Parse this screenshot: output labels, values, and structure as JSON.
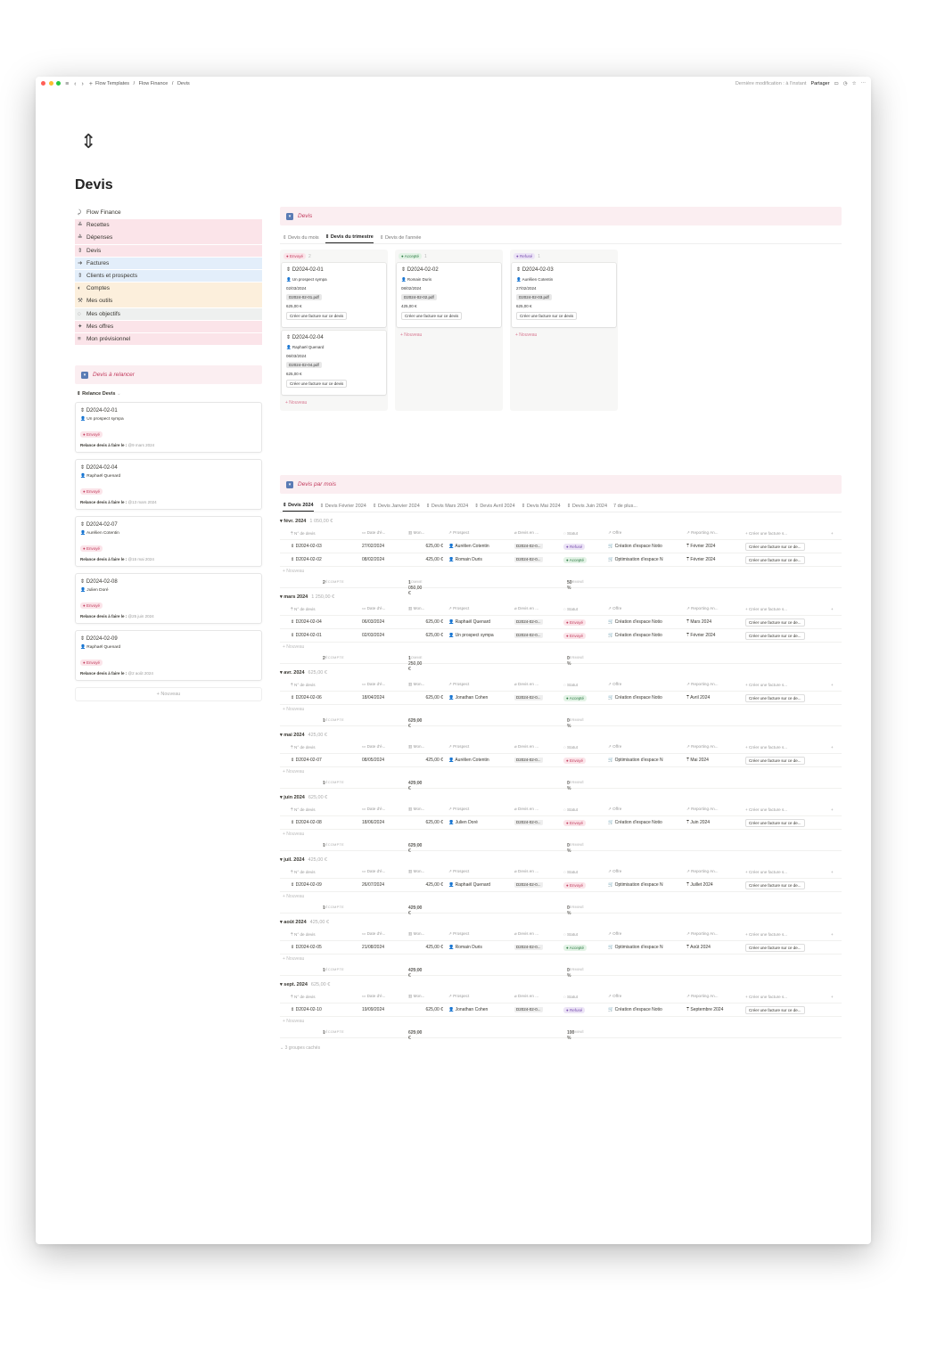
{
  "topbar": {
    "crumbs": [
      "Flow Templates",
      "/",
      "Flow Finance",
      "/",
      "Devis"
    ],
    "last_modified": "Dernière modification : à l'instant",
    "share": "Partager"
  },
  "page": {
    "title": "Devis"
  },
  "nav": [
    {
      "icon": "⤸",
      "label": "Flow Finance",
      "bg": "#ffffff"
    },
    {
      "icon": "≚",
      "label": "Recettes",
      "bg": "#fbe4e9"
    },
    {
      "icon": "≙",
      "label": "Dépenses",
      "bg": "#fbe4e9"
    },
    {
      "icon": "⇕",
      "label": "Devis",
      "bg": "#fbe4e9"
    },
    {
      "icon": "➜",
      "label": "Factures",
      "bg": "#e3eefa"
    },
    {
      "icon": "⇕",
      "label": "Clients et prospects",
      "bg": "#e3eefa"
    },
    {
      "icon": "◐",
      "label": "Comptes",
      "bg": "#fcefdc"
    },
    {
      "icon": "⚒",
      "label": "Mes outils",
      "bg": "#fcefdc"
    },
    {
      "icon": "◌",
      "label": "Mes objectifs",
      "bg": "#eef0ef"
    },
    {
      "icon": "✦",
      "label": "Mes offres",
      "bg": "#fbe4e9"
    },
    {
      "icon": "≡",
      "label": "Mon prévisionnel",
      "bg": "#fbe4e9"
    }
  ],
  "relance": {
    "title": "Devis à relancer",
    "view": "Relance Devis",
    "label": "Relance devis à faire le :",
    "cards": [
      {
        "id": "D2024-02-01",
        "person": "Un prospect sympa",
        "status": "Envoyé",
        "date": "@9 mars 2024"
      },
      {
        "id": "D2024-02-04",
        "person": "Raphaël Quenard",
        "status": "Envoyé",
        "date": "@13 mars 2024"
      },
      {
        "id": "D2024-02-07",
        "person": "Aurélien Cotentin",
        "status": "Envoyé",
        "date": "@15 mai 2024"
      },
      {
        "id": "D2024-02-08",
        "person": "Julien Doré",
        "status": "Envoyé",
        "date": "@25 juin 2024"
      },
      {
        "id": "D2024-02-09",
        "person": "Raphaël Quenard",
        "status": "Envoyé",
        "date": "@2 août 2024"
      }
    ],
    "new": "+ Nouveau"
  },
  "board": {
    "title": "Devis",
    "tabs": [
      "Devis du mois",
      "Devis du trimestre",
      "Devis de l'année"
    ],
    "active_tab": 1,
    "create_label": "Créer une facture sur ce devis",
    "new": "+ Nouveau",
    "columns": [
      {
        "status": "Envoyé",
        "count": "2",
        "cls": "b-env",
        "cards": [
          {
            "id": "D2024-02-01",
            "person": "Un prospect sympa",
            "date": "02/03/2024",
            "pdf": "D2024-02-01.pdf",
            "amount": "625,00 €"
          },
          {
            "id": "D2024-02-04",
            "person": "Raphaël Quenard",
            "date": "06/03/2024",
            "pdf": "D2024-02-04.pdf",
            "amount": "625,00 €"
          }
        ]
      },
      {
        "status": "Accepté",
        "count": "1",
        "cls": "b-acc",
        "cards": [
          {
            "id": "D2024-02-02",
            "person": "Romain Duris",
            "date": "08/02/2024",
            "pdf": "D2024-02-02.pdf",
            "amount": "425,00 €"
          }
        ]
      },
      {
        "status": "Refusé",
        "count": "1",
        "cls": "b-ref",
        "cards": [
          {
            "id": "D2024-02-03",
            "person": "Aurélien Cotentin",
            "date": "27/02/2024",
            "pdf": "D2024-02-03.pdf",
            "amount": "625,00 €"
          }
        ]
      }
    ]
  },
  "monthly": {
    "title": "Devis par mois",
    "tabs": [
      "Devis 2024",
      "Devis Février 2024",
      "Devis Janvier 2024",
      "Devis Mars 2024",
      "Devis Avril 2024",
      "Devis Mai 2024",
      "Devis Juin 2024",
      "7 de plus..."
    ],
    "columns": [
      "N° de devis",
      "Date d'é...",
      "Mon...",
      "Prospect",
      "Devis en ...",
      "Statut",
      "Offre",
      "Reporting An...",
      "Créer une facture s..."
    ],
    "create_cell": "Créer une facture sur ce de...",
    "new_row": "+ Nouveau",
    "calc_count": "DÉCOMPTE",
    "calc_sum": "SOMME",
    "calc_done": "TERMINÉ",
    "groups": [
      {
        "name": "févr. 2024",
        "sum": "1 050,00 €",
        "count": "2",
        "total": "1 050,00 €",
        "done": "50 %",
        "rows": [
          {
            "id": "D2024-02-03",
            "date": "27/02/2024",
            "amount": "625,00 €",
            "person": "Aurélien Cotentin",
            "file": "D2024-02-0...",
            "status": "Refusé",
            "offer": "Création d'espace Notio",
            "report": "Février 2024"
          },
          {
            "id": "D2024-02-02",
            "date": "08/02/2024",
            "amount": "425,00 €",
            "person": "Romain Duris",
            "file": "D2024-02-0...",
            "status": "Accepté",
            "offer": "Optimisation d'espace N",
            "report": "Février 2024"
          }
        ]
      },
      {
        "name": "mars 2024",
        "sum": "1 250,00 €",
        "count": "2",
        "total": "1 250,00 €",
        "done": "0 %",
        "rows": [
          {
            "id": "D2024-02-04",
            "date": "06/03/2024",
            "amount": "625,00 €",
            "person": "Raphaël Quenard",
            "file": "D2024-02-0...",
            "status": "Envoyé",
            "offer": "Création d'espace Notio",
            "report": "Mars 2024"
          },
          {
            "id": "D2024-02-01",
            "date": "02/03/2024",
            "amount": "625,00 €",
            "person": "Un prospect sympa",
            "file": "D2024-02-0...",
            "status": "Envoyé",
            "offer": "Création d'espace Notio",
            "report": "Février 2024"
          }
        ]
      },
      {
        "name": "avr. 2024",
        "sum": "625,00 €",
        "count": "1",
        "total": "625,00 €",
        "done": "0 %",
        "rows": [
          {
            "id": "D2024-02-06",
            "date": "18/04/2024",
            "amount": "625,00 €",
            "person": "Jonathan Cohen",
            "file": "D2024-02-0...",
            "status": "Accepté",
            "offer": "Création d'espace Notio",
            "report": "Avril 2024"
          }
        ]
      },
      {
        "name": "mai 2024",
        "sum": "425,00 €",
        "count": "1",
        "total": "425,00 €",
        "done": "0 %",
        "rows": [
          {
            "id": "D2024-02-07",
            "date": "08/05/2024",
            "amount": "425,00 €",
            "person": "Aurélien Cotentin",
            "file": "D2024-02-0...",
            "status": "Envoyé",
            "offer": "Optimisation d'espace N",
            "report": "Mai 2024"
          }
        ]
      },
      {
        "name": "juin 2024",
        "sum": "625,00 €",
        "count": "1",
        "total": "625,00 €",
        "done": "0 %",
        "rows": [
          {
            "id": "D2024-02-08",
            "date": "18/06/2024",
            "amount": "625,00 €",
            "person": "Julien Doré",
            "file": "D2024-02-0...",
            "status": "Envoyé",
            "offer": "Création d'espace Notio",
            "report": "Juin 2024"
          }
        ]
      },
      {
        "name": "juil. 2024",
        "sum": "425,00 €",
        "count": "1",
        "total": "425,00 €",
        "done": "0 %",
        "rows": [
          {
            "id": "D2024-02-09",
            "date": "26/07/2024",
            "amount": "425,00 €",
            "person": "Raphaël Quenard",
            "file": "D2024-02-0...",
            "status": "Envoyé",
            "offer": "Optimisation d'espace N",
            "report": "Juillet 2024"
          }
        ]
      },
      {
        "name": "août 2024",
        "sum": "425,00 €",
        "count": "1",
        "total": "425,00 €",
        "done": "0 %",
        "rows": [
          {
            "id": "D2024-02-05",
            "date": "21/08/2024",
            "amount": "425,00 €",
            "person": "Romain Duris",
            "file": "D2024-02-0...",
            "status": "Accepté",
            "offer": "Optimisation d'espace N",
            "report": "Août 2024"
          }
        ]
      },
      {
        "name": "sept. 2024",
        "sum": "625,00 €",
        "count": "1",
        "total": "625,00 €",
        "done": "100 %",
        "rows": [
          {
            "id": "D2024-02-10",
            "date": "19/09/2024",
            "amount": "625,00 €",
            "person": "Jonathan Cohen",
            "file": "D2024-02-0...",
            "status": "Refusé",
            "offer": "Création d'espace Notio",
            "report": "Septembre 2024"
          }
        ]
      }
    ],
    "hidden_groups": "3 groupes cachés"
  },
  "colors": {
    "envoye": "#c23b5d",
    "accepte": "#2f7d45",
    "refuse": "#7a4fb0",
    "callout_bg": "#fbeef1"
  }
}
